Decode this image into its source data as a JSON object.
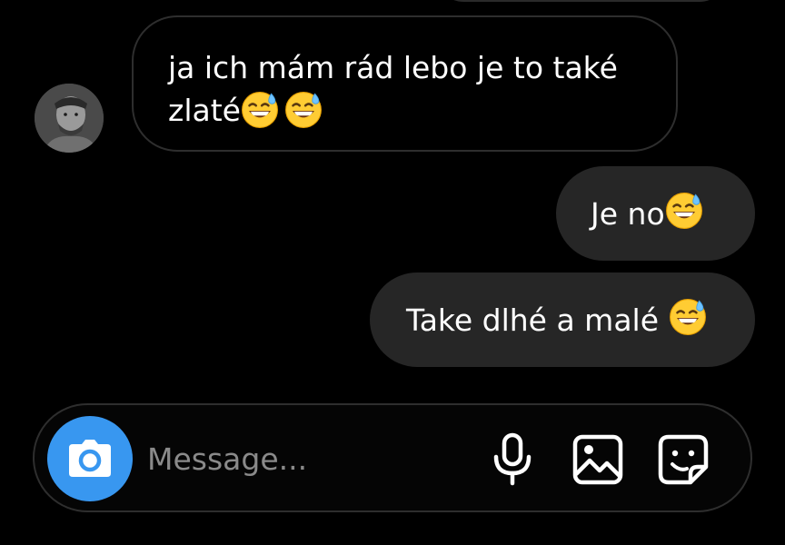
{
  "conversation": {
    "messages": [
      {
        "direction": "incoming",
        "sender_avatar": "avatar-photo",
        "line1": "ja ich mám rád lebo je to také",
        "line2": "zlaté",
        "emojis": [
          "grinning-sweat-emoji",
          "grinning-sweat-emoji"
        ]
      },
      {
        "direction": "outgoing",
        "text": "Je no",
        "emojis": [
          "grinning-sweat-emoji"
        ]
      },
      {
        "direction": "outgoing",
        "text": "Take dlhé a malé ",
        "emojis": [
          "grinning-sweat-emoji"
        ]
      }
    ]
  },
  "composer": {
    "placeholder": "Message...",
    "value": "",
    "icons": {
      "camera": "camera-icon",
      "mic": "microphone-icon",
      "gallery": "gallery-icon",
      "sticker": "sticker-icon"
    }
  },
  "colors": {
    "background": "#000000",
    "outgoing_bubble": "#262626",
    "incoming_bubble_border": "#2e2e2e",
    "accent": "#3897f0",
    "placeholder": "#8a8a8a",
    "text": "#ffffff"
  }
}
